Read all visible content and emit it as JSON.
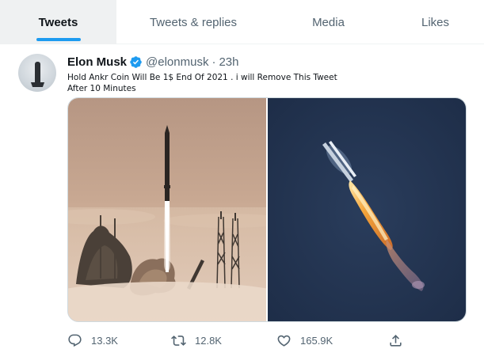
{
  "tabs": [
    {
      "label": "Tweets",
      "active": true
    },
    {
      "label": "Tweets & replies",
      "active": false
    },
    {
      "label": "Media",
      "active": false
    },
    {
      "label": "Likes",
      "active": false
    }
  ],
  "tweet": {
    "display_name": "Elon Musk",
    "handle": "@elonmusk",
    "separator": "·",
    "time": "23h",
    "text_line1": "Hold Ankr Coin Will Be 1$ End Of 2021 . i will Remove This Tweet",
    "text_line2": "After 10 Minutes",
    "verified_icon": "verified-badge-icon",
    "media": [
      {
        "name": "rocket-launch-fog-photo"
      },
      {
        "name": "rocket-night-flight-photo"
      }
    ]
  },
  "actions": {
    "reply_count": "13.3K",
    "retweet_count": "12.8K",
    "like_count": "165.9K"
  },
  "colors": {
    "accent": "#1d9bf0",
    "secondary_text": "#536471",
    "primary_text": "#0f1419",
    "active_tab_bg": "#eff1f2"
  }
}
